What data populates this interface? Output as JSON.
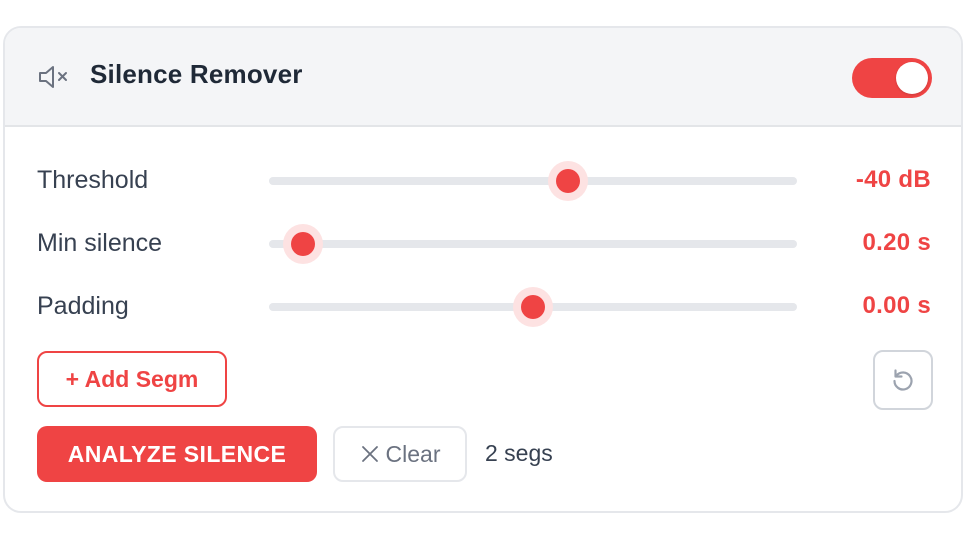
{
  "header": {
    "icon": "speaker-muted-icon",
    "title": "Silence Remover",
    "enabled": true
  },
  "controls": [
    {
      "label": "Threshold",
      "value_text": "-40 dB",
      "slider_fraction": 0.566
    },
    {
      "label": "Min silence",
      "value_text": "0.20 s",
      "slider_fraction": 0.064
    },
    {
      "label": "Padding",
      "value_text": "0.00 s",
      "slider_fraction": 0.5
    }
  ],
  "actions": {
    "add_segment_label": "+ Add Segm",
    "reset_icon": "reset-icon",
    "analyze_label": "ANALYZE SILENCE",
    "clear_icon": "close-icon",
    "clear_label": "Clear",
    "segment_count": "2 segs"
  },
  "colors": {
    "accent": "#ef4444",
    "header_bg": "#f4f5f7",
    "track": "#e5e7eb"
  }
}
